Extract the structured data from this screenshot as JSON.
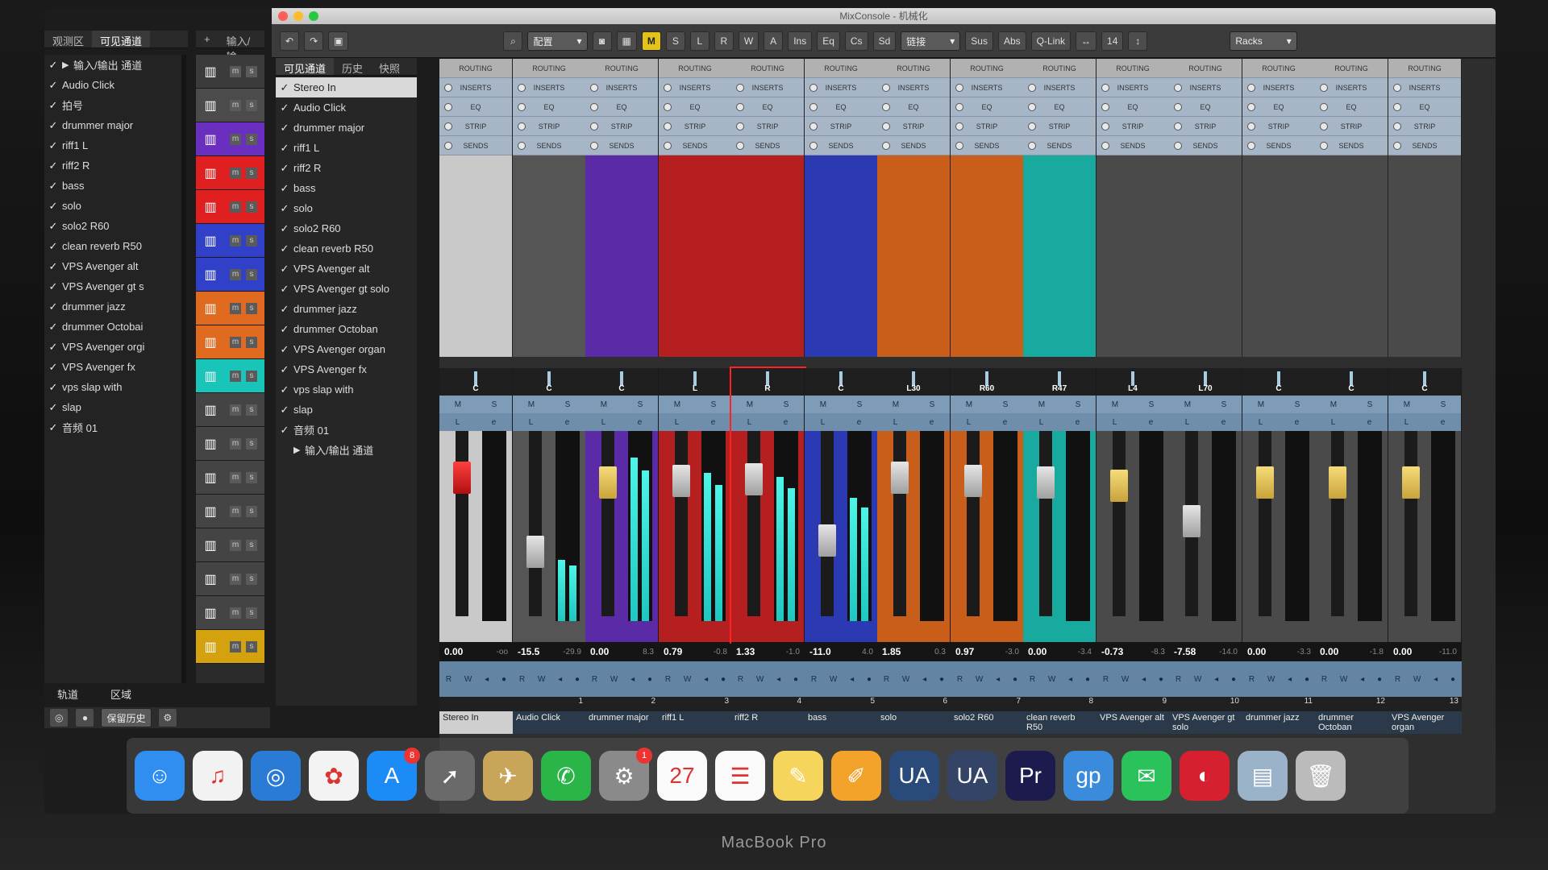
{
  "window_title": "MixConsole - 机械化",
  "device": "MacBook Pro",
  "left_tabs": [
    "观测区",
    "可见通道"
  ],
  "bottom_tabs": [
    "轨道",
    "区域"
  ],
  "keep_history": "保留历史",
  "strip_header": "输入/输",
  "mix_tabs": [
    "可见通道",
    "历史",
    "快照"
  ],
  "icons": {
    "add": "+",
    "history": "◎",
    "record": "●",
    "settings": "⚙",
    "undo": "↶",
    "redo": "↷",
    "layout": "▣",
    "search": "⌕",
    "down": "▾",
    "camera": "◙",
    "grid": "▦",
    "width": "↔",
    "height": "↕",
    "check": "✓",
    "tri": "▶"
  },
  "toolbar": {
    "config": "配置",
    "m": "M",
    "s": "S",
    "l": "L",
    "r": "R",
    "w": "W",
    "a": "A",
    "ins": "Ins",
    "eq": "Eq",
    "cs": "Cs",
    "sd": "Sd",
    "link": "链接",
    "sus": "Sus",
    "abs": "Abs",
    "qlink": "Q-Link",
    "count": "14",
    "racks": "Racks"
  },
  "tracks": [
    "输入/输出 通道",
    "Audio Click",
    "拍号",
    "drummer major",
    "riff1 L",
    "riff2 R",
    "bass",
    "solo",
    "solo2 R60",
    "clean reverb R50",
    "VPS Avenger alt",
    "VPS Avenger gt s",
    "drummer jazz",
    "drummer Octobai",
    "VPS Avenger orgi",
    "VPS Avenger fx",
    "vps slap with",
    "slap",
    "音频 01"
  ],
  "strip_colors": [
    "#3b3b3b",
    "#4b4b4b",
    "#6a2fbf",
    "#e02020",
    "#e02020",
    "#3140c8",
    "#3140c8",
    "#e06a1f",
    "#e06a1f",
    "#19c4b8",
    "#444",
    "#444",
    "#444",
    "#444",
    "#444",
    "#444",
    "#444",
    "#d4a20f"
  ],
  "visible_channels": [
    "Stereo In",
    "Audio Click",
    "drummer major",
    "riff1 L",
    "riff2 R",
    "bass",
    "solo",
    "solo2 R60",
    "clean reverb R50",
    "VPS Avenger alt",
    "VPS Avenger gt solo",
    "drummer jazz",
    "drummer Octoban",
    "VPS Avenger organ",
    "VPS Avenger fx",
    "vps slap with",
    "slap",
    "音频 01",
    "输入/输出 通道"
  ],
  "rack_labels": [
    "ROUTING",
    "INSERTS",
    "EQ",
    "STRIP",
    "SENDS"
  ],
  "channels": [
    {
      "name": "Stereo In",
      "num": "",
      "pan": "C",
      "color": "#c9c9c9",
      "vol": "0.00",
      "peak": "-oo",
      "level": 0,
      "fader": 0.82,
      "red": true
    },
    {
      "name": "Audio Click",
      "num": "1",
      "pan": "C",
      "color": "#555",
      "vol": "-15.5",
      "peak": "-29.9",
      "level": 0.32,
      "fader": 0.38
    },
    {
      "name": "drummer major",
      "num": "2",
      "pan": "C",
      "color": "#5b2aa6",
      "vol": "0.00",
      "peak": "8.3",
      "level": 0.86,
      "fader": 0.79
    },
    {
      "name": "riff1 L",
      "num": "3",
      "pan": "L",
      "color": "#b51f1f",
      "vol": "0.79",
      "peak": "-0.8",
      "level": 0.78,
      "fader": 0.8
    },
    {
      "name": "riff2 R",
      "num": "4",
      "pan": "R",
      "color": "#b51f1f",
      "vol": "1.33",
      "peak": "-1.0",
      "level": 0.76,
      "fader": 0.81,
      "selected": true
    },
    {
      "name": "bass",
      "num": "5",
      "pan": "C",
      "color": "#2b39b3",
      "vol": "-11.0",
      "peak": "4.0",
      "level": 0.65,
      "fader": 0.45
    },
    {
      "name": "solo",
      "num": "6",
      "pan": "L30",
      "color": "#c85e1a",
      "vol": "1.85",
      "peak": "0.3",
      "level": 0,
      "fader": 0.82
    },
    {
      "name": "solo2 R60",
      "num": "7",
      "pan": "R60",
      "color": "#c85e1a",
      "vol": "0.97",
      "peak": "-3.0",
      "level": 0,
      "fader": 0.8
    },
    {
      "name": "clean reverb R50",
      "num": "8",
      "pan": "R47",
      "color": "#18a99f",
      "vol": "0.00",
      "peak": "-3.4",
      "level": 0,
      "fader": 0.79
    },
    {
      "name": "VPS Avenger alt",
      "num": "9",
      "pan": "L4",
      "color": "#4a4a4a",
      "vol": "-0.73",
      "peak": "-8.3",
      "level": 0,
      "fader": 0.77
    },
    {
      "name": "VPS Avenger gt solo",
      "num": "10",
      "pan": "L70",
      "color": "#4a4a4a",
      "vol": "-7.58",
      "peak": "-14.0",
      "level": 0,
      "fader": 0.56
    },
    {
      "name": "drummer jazz",
      "num": "11",
      "pan": "C",
      "color": "#4a4a4a",
      "vol": "0.00",
      "peak": "-3.3",
      "level": 0,
      "fader": 0.79
    },
    {
      "name": "drummer Octoban",
      "num": "12",
      "pan": "C",
      "color": "#4a4a4a",
      "vol": "0.00",
      "peak": "-1.8",
      "level": 0,
      "fader": 0.79
    },
    {
      "name": "VPS Avenger organ",
      "num": "13",
      "pan": "C",
      "color": "#4a4a4a",
      "vol": "0.00",
      "peak": "-11.0",
      "level": 0,
      "fader": 0.79
    }
  ],
  "dock_apps": [
    {
      "name": "finder",
      "glyph": "☺",
      "color": "#2f8ef0"
    },
    {
      "name": "music",
      "glyph": "♫",
      "color": "#f2f2f2"
    },
    {
      "name": "safari",
      "glyph": "◎",
      "color": "#2a7bd6"
    },
    {
      "name": "photos",
      "glyph": "✿",
      "color": "#f3f3f3"
    },
    {
      "name": "app-store",
      "glyph": "A",
      "color": "#1c8bf5",
      "badge": "8"
    },
    {
      "name": "launchpad",
      "glyph": "➚",
      "color": "#6a6a6a"
    },
    {
      "name": "mail-eagle",
      "glyph": "✈",
      "color": "#c9a55a"
    },
    {
      "name": "facetime",
      "glyph": "✆",
      "color": "#29b548"
    },
    {
      "name": "system-preferences",
      "glyph": "⚙",
      "color": "#8a8a8a",
      "badge": "1"
    },
    {
      "name": "calendar",
      "glyph": "27",
      "color": "#fafafa"
    },
    {
      "name": "reminders",
      "glyph": "☰",
      "color": "#fafafa"
    },
    {
      "name": "notes",
      "glyph": "✎",
      "color": "#f6d55c"
    },
    {
      "name": "pages",
      "glyph": "✐",
      "color": "#f3a32a"
    },
    {
      "name": "ua-console",
      "glyph": "UA",
      "color": "#2a4a7a"
    },
    {
      "name": "ua-meter",
      "glyph": "UA",
      "color": "#334466"
    },
    {
      "name": "premiere",
      "glyph": "Pr",
      "color": "#1d1b4d"
    },
    {
      "name": "guitar-pro",
      "glyph": "gp",
      "color": "#3a8bdc"
    },
    {
      "name": "wechat",
      "glyph": "✉",
      "color": "#29c25b"
    },
    {
      "name": "cubase",
      "glyph": "◐",
      "color": "#d62030"
    },
    {
      "name": "preview",
      "glyph": "▤",
      "color": "#9bb3c9"
    },
    {
      "name": "trash",
      "glyph": "🗑",
      "color": "#bbb"
    }
  ]
}
